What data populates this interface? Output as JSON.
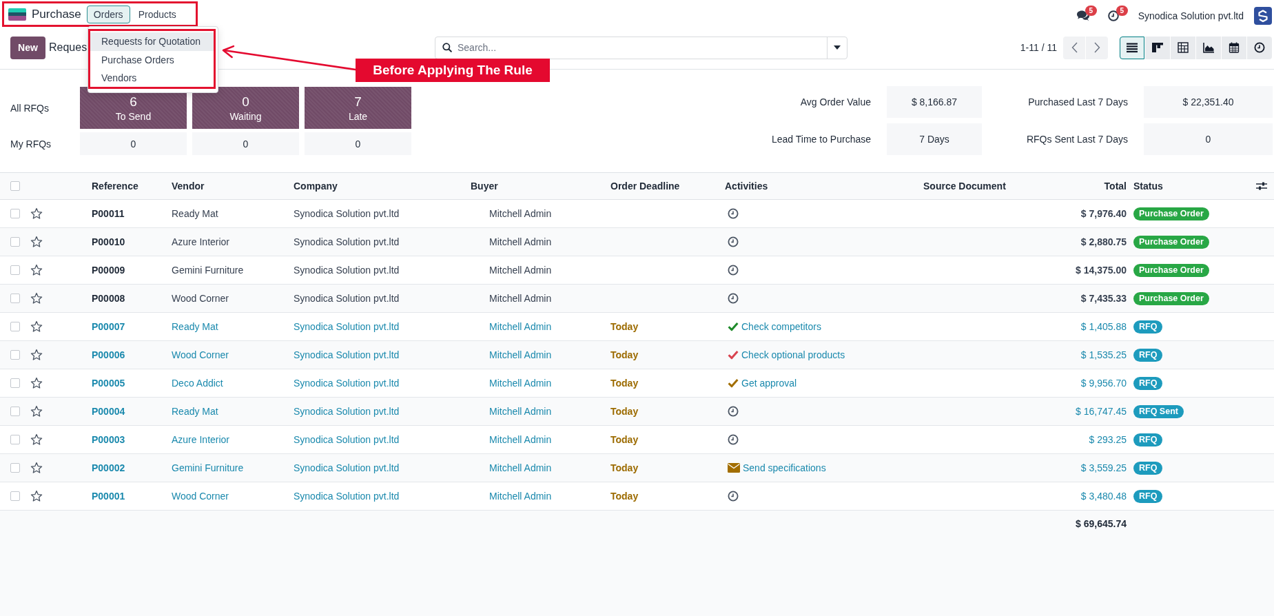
{
  "navbar": {
    "app_name": "Purchase",
    "menu": [
      {
        "label": "Orders",
        "selected": true
      },
      {
        "label": "Products",
        "selected": false
      }
    ],
    "messages_count": "5",
    "activities_count": "5",
    "company": "Synodica Solution pvt.ltd"
  },
  "orders_menu": {
    "items": [
      {
        "label": "Requests for Quotation",
        "selected": true
      },
      {
        "label": "Purchase Orders",
        "selected": false
      },
      {
        "label": "Vendors",
        "selected": false
      }
    ]
  },
  "annotation": {
    "text": "Before Applying The Rule"
  },
  "control_panel": {
    "new_button": "New",
    "title": "Reques",
    "search": {
      "placeholder": "Search..."
    },
    "pager": "1-11 / 11",
    "views": [
      {
        "kind": "list",
        "selected": true
      },
      {
        "kind": "kanban",
        "selected": false
      },
      {
        "kind": "pivot",
        "selected": false
      },
      {
        "kind": "graph",
        "selected": false
      },
      {
        "kind": "calendar",
        "selected": false
      },
      {
        "kind": "activity",
        "selected": false
      }
    ]
  },
  "dashboard": {
    "rows": [
      {
        "kind": "tiles",
        "label": "All RFQs",
        "cells": [
          {
            "value": "6",
            "caption": "To Send"
          },
          {
            "value": "0",
            "caption": "Waiting"
          },
          {
            "value": "7",
            "caption": "Late"
          }
        ]
      },
      {
        "kind": "plain",
        "label": "My RFQs",
        "cells": [
          {
            "value": "0"
          },
          {
            "value": "0"
          },
          {
            "value": "0"
          }
        ]
      }
    ],
    "stats": [
      {
        "label": "Avg Order Value",
        "value": "$ 8,166.87"
      },
      {
        "label": "Purchased Last 7 Days",
        "value": "$ 22,351.40"
      },
      {
        "label": "Lead Time to Purchase",
        "value": "7 Days"
      },
      {
        "label": "RFQs Sent Last 7 Days",
        "value": "0"
      }
    ]
  },
  "table": {
    "all_selected": false,
    "columns": [
      "Reference",
      "Vendor",
      "Company",
      "Buyer",
      "Order Deadline",
      "Activities",
      "Source Document",
      "Total",
      "Status"
    ],
    "rows": [
      {
        "kind": "order",
        "selected": false,
        "starred": false,
        "reference": "P00011",
        "vendor": "Ready Mat",
        "company": "Synodica Solution pvt.ltd",
        "buyer": "Mitchell Admin",
        "activity": {
          "kind": "none"
        },
        "total": "$ 7,976.40",
        "status": {
          "label": "Purchase Order",
          "color": "#28a745"
        }
      },
      {
        "kind": "order",
        "selected": false,
        "starred": false,
        "reference": "P00010",
        "vendor": "Azure Interior",
        "company": "Synodica Solution pvt.ltd",
        "buyer": "Mitchell Admin",
        "activity": {
          "kind": "none"
        },
        "total": "$ 2,880.75",
        "status": {
          "label": "Purchase Order",
          "color": "#28a745"
        }
      },
      {
        "kind": "order",
        "selected": false,
        "starred": false,
        "reference": "P00009",
        "vendor": "Gemini Furniture",
        "company": "Synodica Solution pvt.ltd",
        "buyer": "Mitchell Admin",
        "activity": {
          "kind": "none"
        },
        "total": "$ 14,375.00",
        "status": {
          "label": "Purchase Order",
          "color": "#28a745"
        }
      },
      {
        "kind": "order",
        "selected": false,
        "starred": false,
        "reference": "P00008",
        "vendor": "Wood Corner",
        "company": "Synodica Solution pvt.ltd",
        "buyer": "Mitchell Admin",
        "activity": {
          "kind": "none"
        },
        "total": "$ 7,435.33",
        "status": {
          "label": "Purchase Order",
          "color": "#28a745"
        }
      },
      {
        "kind": "rfq",
        "selected": false,
        "starred": false,
        "reference": "P00007",
        "vendor": "Ready Mat",
        "company": "Synodica Solution pvt.ltd",
        "buyer": "Mitchell Admin",
        "deadline": "Today",
        "activity": {
          "kind": "check",
          "color": "#1e8a2a",
          "summary": "Check competitors"
        },
        "total": "$ 1,405.88",
        "status": {
          "label": "RFQ",
          "color": "#1d9bbd"
        }
      },
      {
        "kind": "rfq",
        "selected": false,
        "starred": false,
        "reference": "P00006",
        "vendor": "Wood Corner",
        "company": "Synodica Solution pvt.ltd",
        "buyer": "Mitchell Admin",
        "deadline": "Today",
        "activity": {
          "kind": "check",
          "color": "#d9434f",
          "summary": "Check optional products"
        },
        "total": "$ 1,535.25",
        "status": {
          "label": "RFQ",
          "color": "#1d9bbd"
        }
      },
      {
        "kind": "rfq",
        "selected": false,
        "starred": false,
        "reference": "P00005",
        "vendor": "Deco Addict",
        "company": "Synodica Solution pvt.ltd",
        "buyer": "Mitchell Admin",
        "deadline": "Today",
        "activity": {
          "kind": "check",
          "color": "#a26e00",
          "summary": "Get approval"
        },
        "total": "$ 9,956.70",
        "status": {
          "label": "RFQ",
          "color": "#1d9bbd"
        }
      },
      {
        "kind": "rfq",
        "selected": false,
        "starred": false,
        "reference": "P00004",
        "vendor": "Ready Mat",
        "company": "Synodica Solution pvt.ltd",
        "buyer": "Mitchell Admin",
        "deadline": "Today",
        "activity": {
          "kind": "none"
        },
        "total": "$ 16,747.45",
        "status": {
          "label": "RFQ Sent",
          "color": "#1d9bbd"
        }
      },
      {
        "kind": "rfq",
        "selected": false,
        "starred": false,
        "reference": "P00003",
        "vendor": "Azure Interior",
        "company": "Synodica Solution pvt.ltd",
        "buyer": "Mitchell Admin",
        "deadline": "Today",
        "activity": {
          "kind": "none"
        },
        "total": "$ 293.25",
        "status": {
          "label": "RFQ",
          "color": "#1d9bbd"
        }
      },
      {
        "kind": "rfq",
        "selected": false,
        "starred": false,
        "reference": "P00002",
        "vendor": "Gemini Furniture",
        "company": "Synodica Solution pvt.ltd",
        "buyer": "Mitchell Admin",
        "deadline": "Today",
        "activity": {
          "kind": "email",
          "color": "#a26e00",
          "summary": "Send specifications"
        },
        "total": "$ 3,559.25",
        "status": {
          "label": "RFQ",
          "color": "#1d9bbd"
        }
      },
      {
        "kind": "rfq",
        "selected": false,
        "starred": false,
        "reference": "P00001",
        "vendor": "Wood Corner",
        "company": "Synodica Solution pvt.ltd",
        "buyer": "Mitchell Admin",
        "deadline": "Today",
        "activity": {
          "kind": "none"
        },
        "total": "$ 3,480.48",
        "status": {
          "label": "RFQ",
          "color": "#1d9bbd"
        }
      }
    ],
    "grand_total": "$ 69,645.74"
  }
}
